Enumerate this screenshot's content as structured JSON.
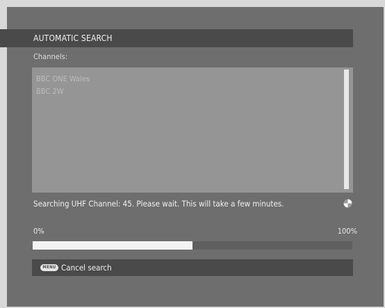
{
  "header": {
    "title": "AUTOMATIC SEARCH"
  },
  "channels": {
    "label": "Channels:",
    "items": [
      "BBC ONE Wales",
      "BBC 2W"
    ]
  },
  "status": {
    "text": "Searching UHF Channel: 45. Please wait. This will take a few minutes."
  },
  "progress": {
    "start_label": "0%",
    "end_label": "100%",
    "value_fraction": 0.5
  },
  "footer": {
    "key_label": "MENU",
    "action_label": "Cancel search"
  },
  "icons": {
    "status": "spinner-icon",
    "footer_key": "menu-key-icon"
  },
  "colors": {
    "background": "#6e6e6e",
    "bar": "#4a4a4a",
    "list": "#959595",
    "progress": "#f4f4f4"
  }
}
